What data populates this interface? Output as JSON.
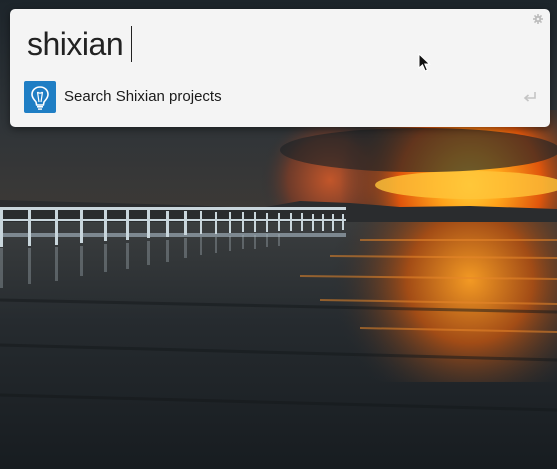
{
  "launcher": {
    "query": "shixian",
    "settings_icon": "gear-icon",
    "result": {
      "icon": "lightbulb-icon",
      "label": "Search Shixian projects",
      "action_icon": "return-key-icon"
    }
  },
  "colors": {
    "accent": "#1f7ec4",
    "panel": "#f4f4f4",
    "text": "#222222"
  }
}
